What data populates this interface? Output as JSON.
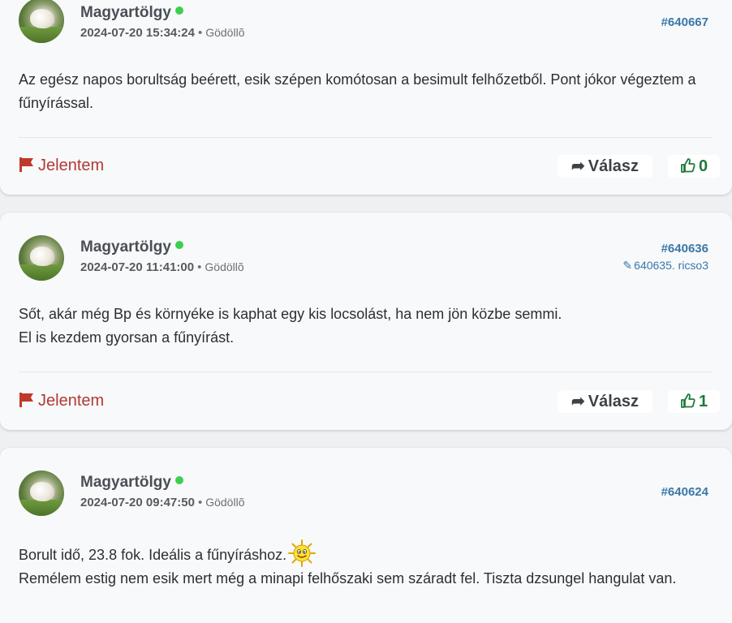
{
  "posts": [
    {
      "author": "Magyartölgy",
      "timestamp": "2024-07-20 15:34:24",
      "separator": "•",
      "location": "Gödöllõ",
      "post_id": "#640667",
      "reply_ref": "",
      "body": [
        "Az egész napos borultság beérett, esik szépen komótosan a besimult felhőzetből. Pont jókor végeztem a fűnyírással."
      ],
      "report_label": "Jelentem",
      "reply_label": "Válasz",
      "likes": "0"
    },
    {
      "author": "Magyartölgy",
      "timestamp": "2024-07-20 11:41:00",
      "separator": "•",
      "location": "Gödöllõ",
      "post_id": "#640636",
      "reply_ref": "640635. ricso3",
      "body": [
        "Sőt, akár még Bp és környéke is kaphat egy kis locsolást, ha nem jön közbe semmi.",
        "El is kezdem gyorsan a fűnyírást."
      ],
      "report_label": "Jelentem",
      "reply_label": "Válasz",
      "likes": "1"
    },
    {
      "author": "Magyartölgy",
      "timestamp": "2024-07-20 09:47:50",
      "separator": "•",
      "location": "Gödöllõ",
      "post_id": "#640624",
      "reply_ref": "",
      "body": [
        "Borult idő, 23.8 fok. Ideális a fűnyíráshoz.",
        "Remélem estig nem esik mert még a minapi felhőszaki sem száradt fel. Tiszta dzsungel hangulat van."
      ],
      "emoticon": "sun-smiley-icon"
    }
  ],
  "colors": {
    "author": "#4a4f55",
    "online": "#3ccf4e",
    "post_id": "#3a77a8",
    "report": "#b23a35",
    "like": "#1f7a3a",
    "card_bg": "#f8f9fa"
  }
}
